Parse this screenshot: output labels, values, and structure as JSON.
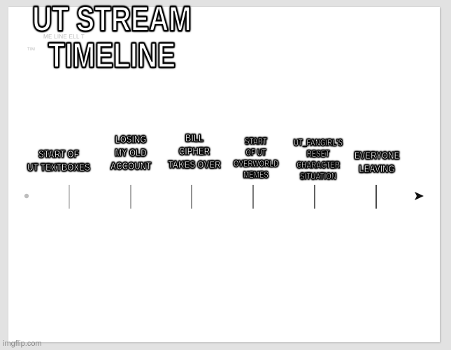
{
  "meme": {
    "title": "UT STREAM\nTIMELINE",
    "background_fragments": [
      "ME LINE  ELL  T",
      "TIM"
    ],
    "events": [
      {
        "label": "START OF\nUT TEXTBOXES",
        "size": "normal"
      },
      {
        "label": "LOSING\nMY OLD\nACCOUNT",
        "size": "normal"
      },
      {
        "label": "BILL\nCIPHER\nTAKES OVER",
        "size": "normal"
      },
      {
        "label": "START\nOF UT\nOVERWORLD\nMEMES",
        "size": "small"
      },
      {
        "label": "UT_FANGIRL'S\nRESET\nCHARACTER\nSITUATION",
        "size": "small"
      },
      {
        "label": "EVERYONE\nLEAVING",
        "size": "normal"
      }
    ],
    "watermark": "imgflip.com"
  },
  "colors": {
    "line_start": "#c4c4c4",
    "line_end": "#1a1a1a",
    "text": "#ffffff",
    "outline": "#000000"
  }
}
